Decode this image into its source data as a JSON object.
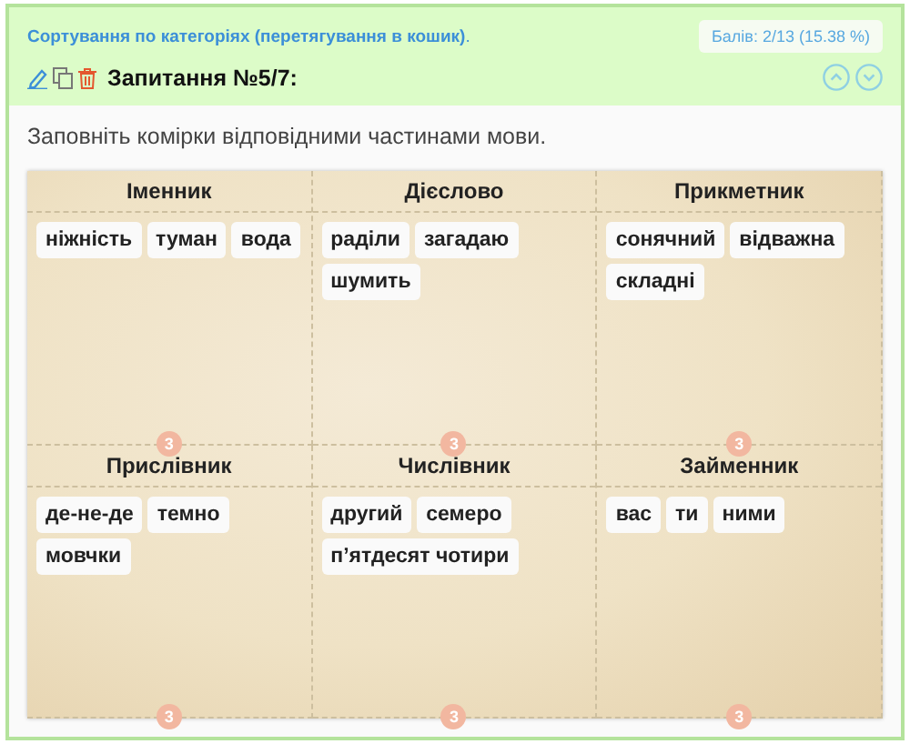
{
  "header": {
    "task_type": "Сортування по категоріях (перетягування в кошик)",
    "task_type_end": ".",
    "score": "Балів: 2/13 (15.38 %)",
    "question": "Запитання №5/7:"
  },
  "instruction": "Заповніть комірки відповідними частинами мови.",
  "categories": [
    {
      "title": "Іменник",
      "count": "3",
      "words": [
        "ніжність",
        "туман",
        "вода"
      ]
    },
    {
      "title": "Дієслово",
      "count": "3",
      "words": [
        "раділи",
        "загадаю",
        "шумить"
      ]
    },
    {
      "title": "Прикметник",
      "count": "3",
      "words": [
        "сонячний",
        "відважна",
        "складні"
      ]
    },
    {
      "title": "Прислівник",
      "count": "3",
      "words": [
        "де-не-де",
        "темно",
        "мовчки"
      ]
    },
    {
      "title": "Числівник",
      "count": "3",
      "words": [
        "другий",
        "семеро",
        "п’ятдесят чотири"
      ]
    },
    {
      "title": "Займенник",
      "count": "3",
      "words": [
        "вас",
        "ти",
        "ними"
      ]
    }
  ]
}
